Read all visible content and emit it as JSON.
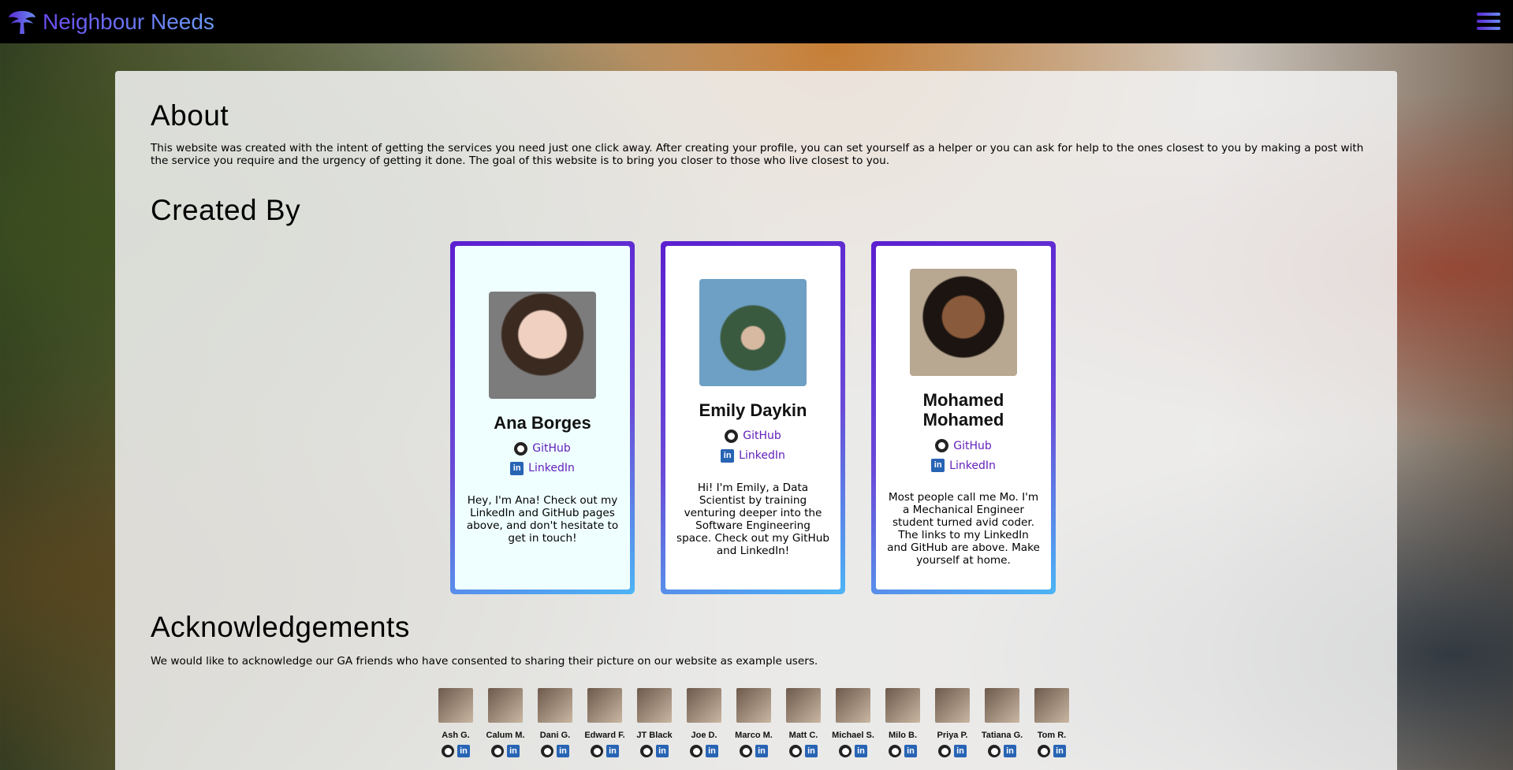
{
  "nav": {
    "brand": "Neighbour Needs",
    "logo_icon": "tree-icon",
    "menu_icon": "hamburger-menu-icon"
  },
  "about": {
    "title": "About",
    "text": "This website was created with the intent of getting the services you need just one click away. After creating your profile, you can set yourself as a helper or you can ask for help to the ones closest to you by making a post with the service you require and the urgency of getting it done. The goal of this website is to bring you closer to those who live closest to you."
  },
  "created_by": {
    "title": "Created By",
    "creators": [
      {
        "name": "Ana Borges",
        "github": "GitHub",
        "linkedin": "LinkedIn",
        "bio": "Hey, I'm Ana! Check out my LinkedIn and GitHub pages above, and don't hesitate to get in touch!"
      },
      {
        "name": "Emily Daykin",
        "github": "GitHub",
        "linkedin": "LinkedIn",
        "bio": "Hi! I'm Emily, a Data Scientist by training venturing deeper into the Software Engineering space. Check out my GitHub and LinkedIn!"
      },
      {
        "name": "Mohamed Mohamed",
        "github": "GitHub",
        "linkedin": "LinkedIn",
        "bio": "Most people call me Mo. I'm a Mechanical Engineer student turned avid coder. The links to my LinkedIn and GitHub are above. Make yourself at home."
      }
    ]
  },
  "acknowledgements": {
    "title": "Acknowledgements",
    "text": "We would like to acknowledge our GA friends who have consented to sharing their picture on our website as example users.",
    "friends": [
      "Ash G.",
      "Calum M.",
      "Dani G.",
      "Edward F.",
      "JT Black",
      "Joe D.",
      "Marco M.",
      "Matt C.",
      "Michael S.",
      "Milo B.",
      "Priya P.",
      "Tatiana G.",
      "Tom R."
    ]
  },
  "colors": {
    "accent": "#6220b8",
    "card_gradient_start": "#5b1fd0",
    "card_gradient_end": "#4db5f5",
    "navbar": "#000000"
  }
}
